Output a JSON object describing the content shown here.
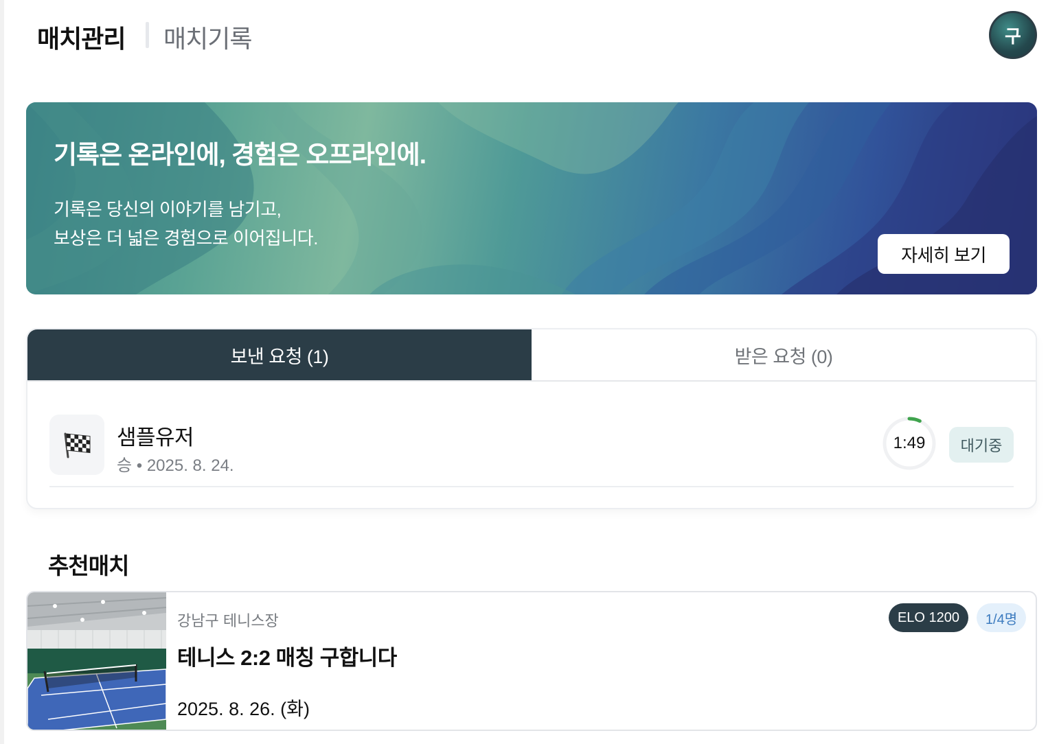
{
  "header": {
    "active_tab": "매치관리",
    "other_tab": "매치기록",
    "avatar_initial": "구"
  },
  "banner": {
    "title": "기록은 온라인에, 경험은 오프라인에.",
    "line1": "기록은 당신의 이야기를 남기고,",
    "line2": "보상은 더 넓은 경험으로 이어집니다.",
    "button_label": "자세히 보기"
  },
  "requests": {
    "tabs": [
      {
        "label": "보낸 요청 (1)",
        "active": true
      },
      {
        "label": "받은 요청 (0)",
        "active": false
      }
    ],
    "items": [
      {
        "icon": "checkered-flag-icon",
        "name": "샘플유저",
        "meta": "승 • 2025. 8. 24.",
        "timer": "1:49",
        "timer_progress": 0.07,
        "status": "대기중"
      }
    ]
  },
  "recommended": {
    "title": "추천매치",
    "items": [
      {
        "location": "강남구 테니스장",
        "title": "테니스 2:2 매칭 구합니다",
        "date": "2025. 8. 26. (화)",
        "elo": "ELO 1200",
        "count": "1/4명"
      }
    ]
  },
  "colors": {
    "accent": "#2b3d47",
    "status_bg": "#e3f0f0",
    "timer_green": "#3fa34d",
    "count_blue": "#3c7bbf"
  }
}
